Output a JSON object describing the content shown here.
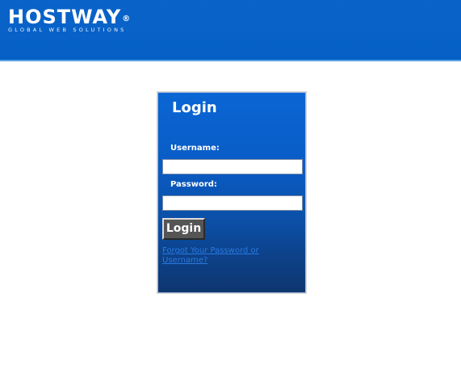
{
  "header": {
    "brand_name": "HOSTWAY",
    "brand_mark": "®",
    "tagline": "GLOBAL WEB SOLUTIONS"
  },
  "login": {
    "title": "Login",
    "username_label": "Username:",
    "username_value": "",
    "password_label": "Password:",
    "password_value": "",
    "button_label": "Login",
    "forgot_link": "Forgot Your Password or Username?"
  },
  "colors": {
    "header_blue": "#0560c6",
    "panel_top": "#0a66d4",
    "panel_bottom": "#0e3670",
    "button_gray": "#555555",
    "link_blue": "#2a7ae2"
  }
}
